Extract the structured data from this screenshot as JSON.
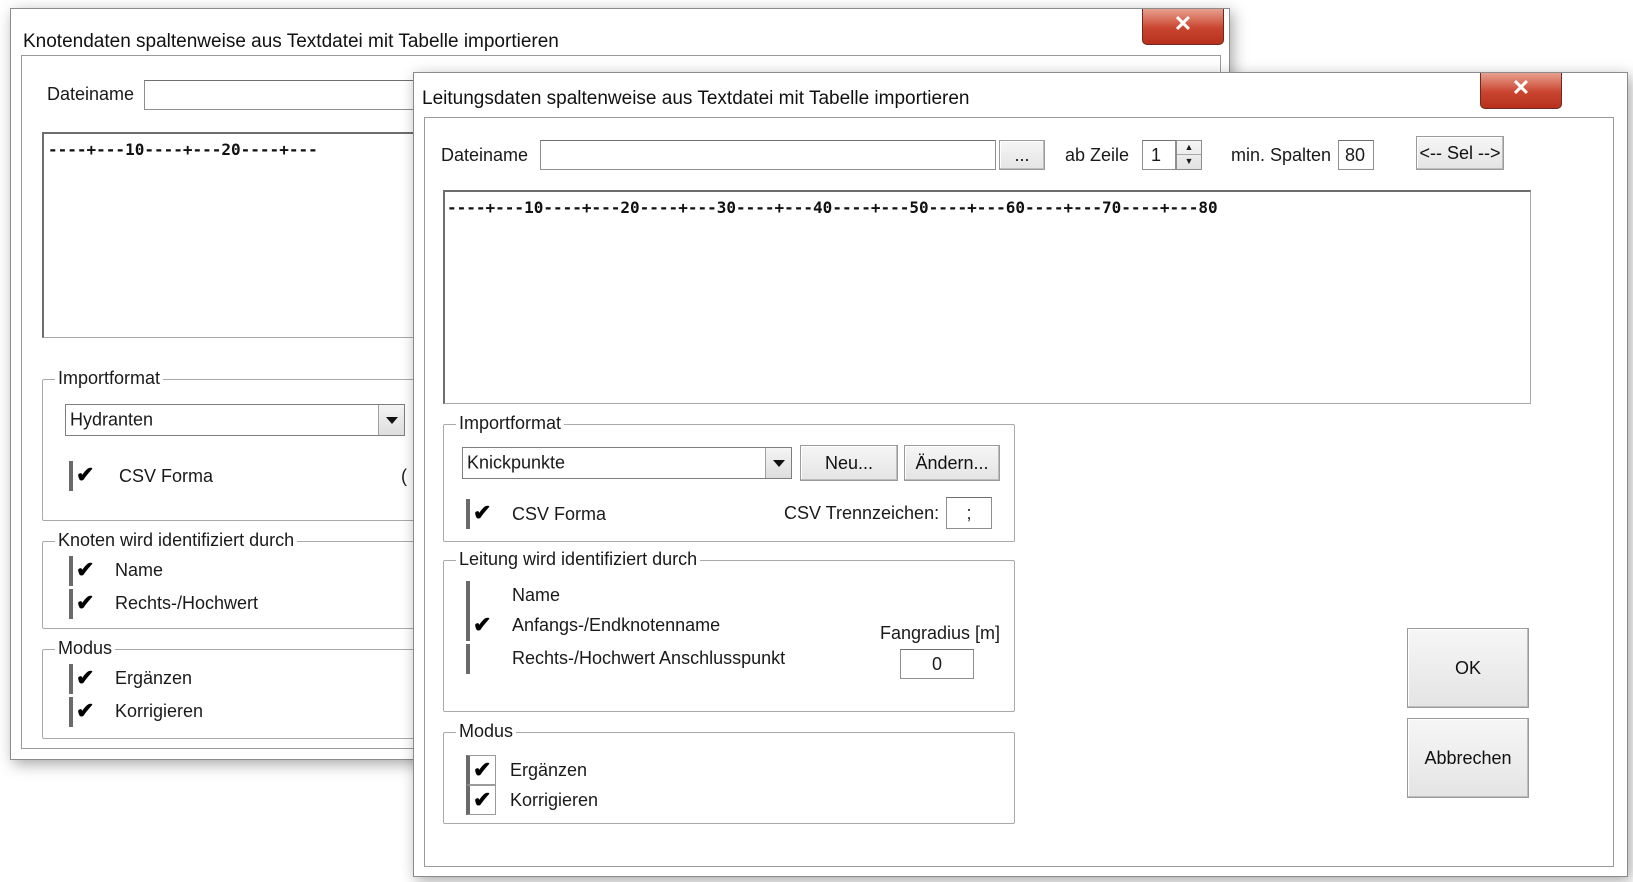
{
  "back_window": {
    "title": "Knotendaten spaltenweise aus Textdatei mit Tabelle importieren",
    "close_label": "✕",
    "filename_label": "Dateiname",
    "ruler": "----+---10----+---20----+---",
    "importformat_title": "Importformat",
    "format_selected": "Hydranten",
    "csv_label": "CSV Forma",
    "csv_checked_mark": "✔",
    "stray_char": "(",
    "identified_title": "Knoten wird identifiziert durch",
    "identified": [
      {
        "label": "Name",
        "mark": "✔"
      },
      {
        "label": "Rechts-/Hochwert",
        "mark": "✔"
      }
    ],
    "modus_title": "Modus",
    "modus": [
      {
        "label": "Ergänzen",
        "mark": "✔"
      },
      {
        "label": "Korrigieren",
        "mark": "✔"
      }
    ]
  },
  "front_window": {
    "title": "Leitungsdaten spaltenweise aus Textdatei mit Tabelle importieren",
    "close_label": "✕",
    "filename_label": "Dateiname",
    "filename_value": "",
    "browse_label": "...",
    "ab_zeile_label": "ab Zeile",
    "ab_zeile_value": "1",
    "min_spalten_label": "min. Spalten",
    "min_spalten_value": "80",
    "sel_button": "<-- Sel -->",
    "ruler": "----+---10----+---20----+---30----+---40----+---50----+---60----+---70----+---80",
    "importformat_title": "Importformat",
    "format_selected": "Knickpunkte",
    "neu_button": "Neu...",
    "aendern_button": "Ändern...",
    "csv_label": "CSV Forma",
    "csv_checked_mark": "✔",
    "csv_separator_label": "CSV Trennzeichen:",
    "csv_separator_value": ";",
    "identified_title": "Leitung wird identifiziert durch",
    "identified": [
      {
        "label": "Name",
        "mark": ""
      },
      {
        "label": "Anfangs-/Endknotenname",
        "mark": "✔"
      },
      {
        "label": "Rechts-/Hochwert Anschlusspunkt",
        "mark": ""
      }
    ],
    "fangradius_label": "Fangradius [m]",
    "fangradius_value": "0",
    "modus_title": "Modus",
    "modus": [
      {
        "label": "Ergänzen",
        "mark": "✔"
      },
      {
        "label": "Korrigieren",
        "mark": "✔"
      }
    ],
    "ok_button": "OK",
    "cancel_button": "Abbrechen"
  }
}
